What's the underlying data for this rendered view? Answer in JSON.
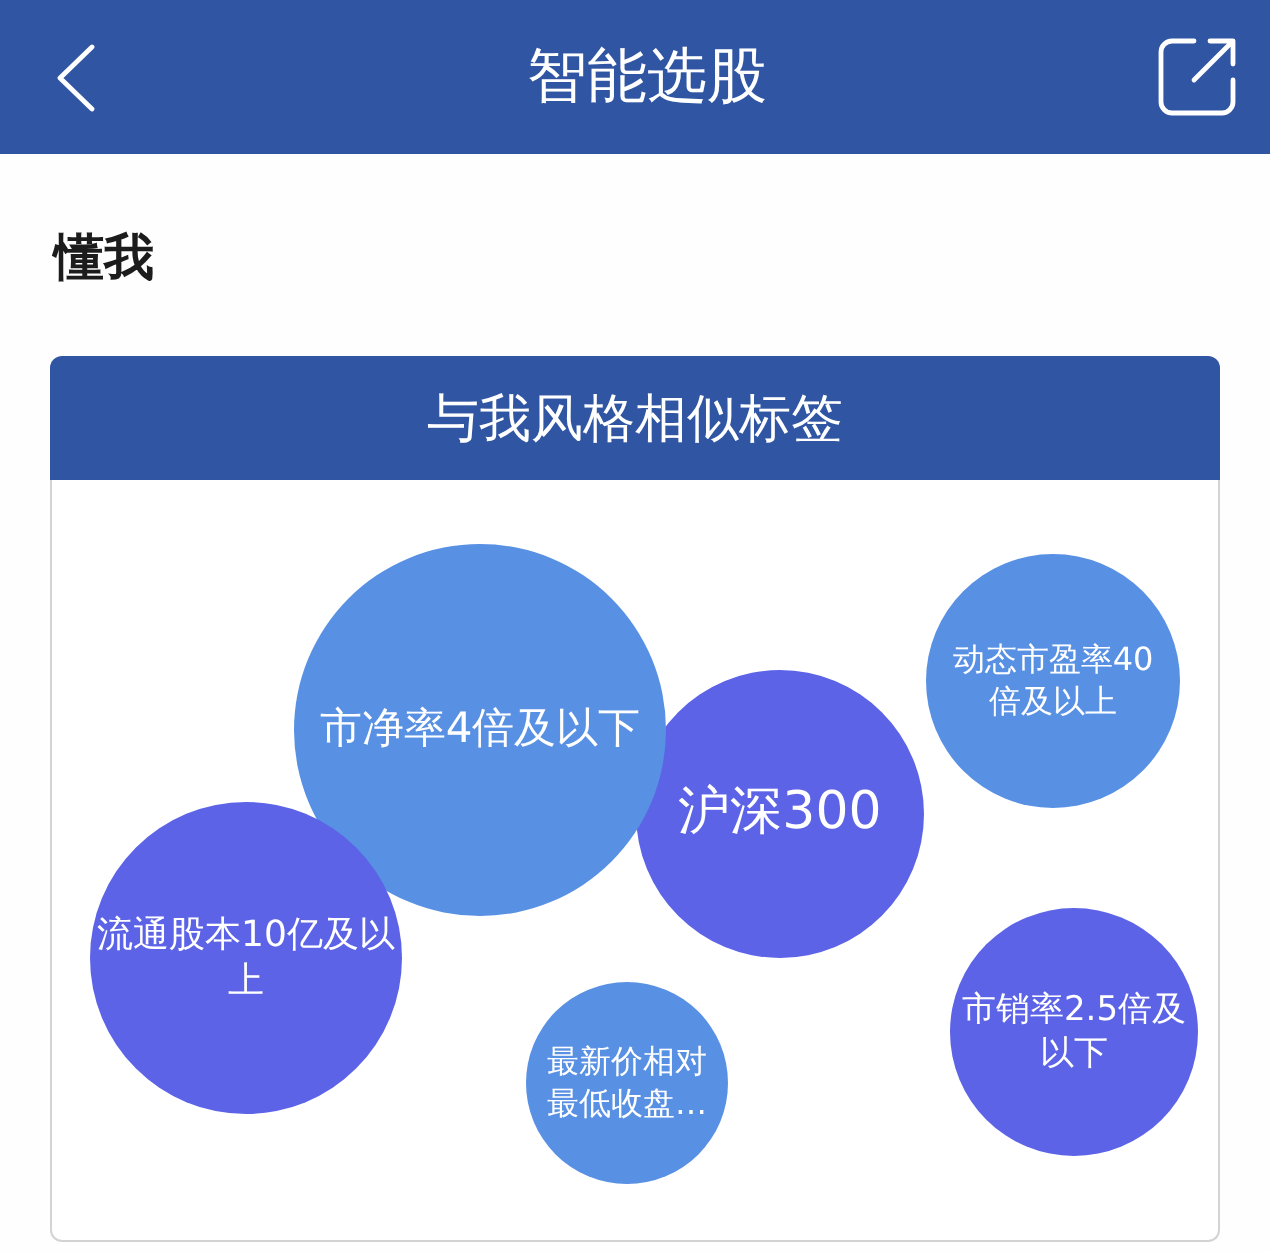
{
  "header": {
    "title": "智能选股"
  },
  "section": {
    "title": "懂我"
  },
  "card": {
    "title": "与我风格相似标签",
    "tags": [
      {
        "label": "市净率4倍及以下",
        "color": "#5890e4"
      },
      {
        "label": "沪深300",
        "color": "#5c63e7"
      },
      {
        "label": "动态市盈率40倍及以上",
        "color": "#5890e4"
      },
      {
        "label": "流通股本10亿及以上",
        "color": "#5c63e7"
      },
      {
        "label": "最新价相对最低收盘…",
        "color": "#5890e4"
      },
      {
        "label": "市销率2.5倍及以下",
        "color": "#5c63e7"
      }
    ]
  }
}
